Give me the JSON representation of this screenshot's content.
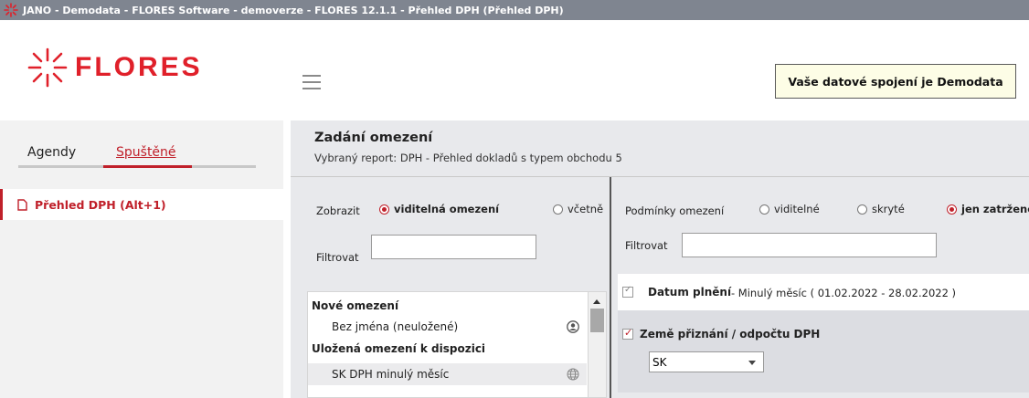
{
  "window": {
    "title": "JANO - Demodata - FLORES Software - demoverze - FLORES 12.1.1 - Přehled DPH  (Přehled DPH)"
  },
  "header": {
    "logo_text": "FLORES",
    "connection_label": "Vaše datové spojení je Demodata"
  },
  "sidebar": {
    "tabs": [
      {
        "label": "Agendy"
      },
      {
        "label": "Spuštěné"
      }
    ],
    "items": [
      {
        "label": "Přehled DPH (Alt+1)"
      }
    ]
  },
  "main": {
    "title": "Zadání omezení",
    "subtitle": "Vybraný report: DPH - Přehled dokladů s typem obchodu 5",
    "left": {
      "show_label": "Zobrazit",
      "show_options": [
        "viditelná omezení",
        "včetně"
      ],
      "filter_label": "Filtrovat",
      "filter_value": "",
      "list": {
        "new_header": "Nové omezení",
        "new_item": "Bez jména (neuložené)",
        "saved_header": "Uložená omezení k dispozici",
        "saved_item": "SK DPH minulý měsíc"
      }
    },
    "right": {
      "conditions_label": "Podmínky omezení",
      "options": [
        "viditelné",
        "skryté",
        "jen zatržené"
      ],
      "filter_label": "Filtrovat",
      "filter_value": "",
      "cond1": {
        "title": "Datum plnění",
        "detail": "- Minulý měsíc ( 01.02.2022 - 28.02.2022 )"
      },
      "cond2": {
        "title": "Země přiznání / odpočtu DPH",
        "select_value": "SK"
      }
    }
  }
}
